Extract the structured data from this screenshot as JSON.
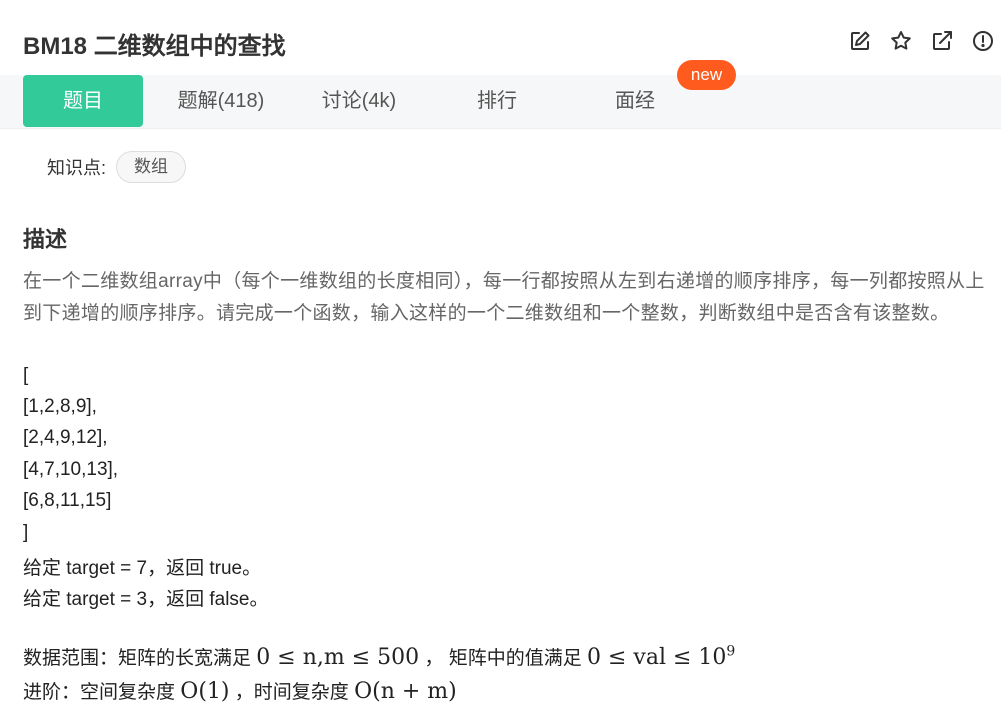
{
  "header": {
    "title": "BM18  二维数组中的查找",
    "icons": [
      "edit-icon",
      "star-icon",
      "external-link-icon",
      "info-icon"
    ]
  },
  "tabs": [
    {
      "label": "题目",
      "active": true
    },
    {
      "label": "题解(418)",
      "active": false
    },
    {
      "label": "讨论(4k)",
      "active": false
    },
    {
      "label": "排行",
      "active": false
    },
    {
      "label": "面经",
      "active": false
    }
  ],
  "badge_new": "new",
  "knowledge": {
    "label": "知识点:",
    "tag": "数组"
  },
  "description": {
    "heading": "描述",
    "text": "在一个二维数组array中（每个一维数组的长度相同），每一行都按照从左到右递增的顺序排序，每一列都按照从上到下递增的顺序排序。请完成一个函数，输入这样的一个二维数组和一个整数，判断数组中是否含有该整数。",
    "matrix_lines": [
      "[",
      "[1,2,8,9],",
      "[2,4,9,12],",
      "[4,7,10,13],",
      "[6,8,11,15]",
      "]"
    ],
    "example1": "给定 target = 7，返回 true。",
    "example2": "给定 target = 3，返回 false。",
    "range_prefix": "数据范围：矩阵的长宽满足",
    "range_math1": "0 ≤ n,m ≤ 500",
    "range_middle": "，  矩阵中的值满足",
    "range_math2": "0 ≤ val ≤ 10",
    "range_exp": "9",
    "advanced_prefix": "进阶：空间复杂度",
    "advanced_math1": "O(1)",
    "advanced_middle": "，时间复杂度",
    "advanced_math2": "O(n + m)"
  },
  "colors": {
    "accent": "#32ca99",
    "badge": "#ff5b1f",
    "tabbar_bg": "#f6f7f8"
  }
}
